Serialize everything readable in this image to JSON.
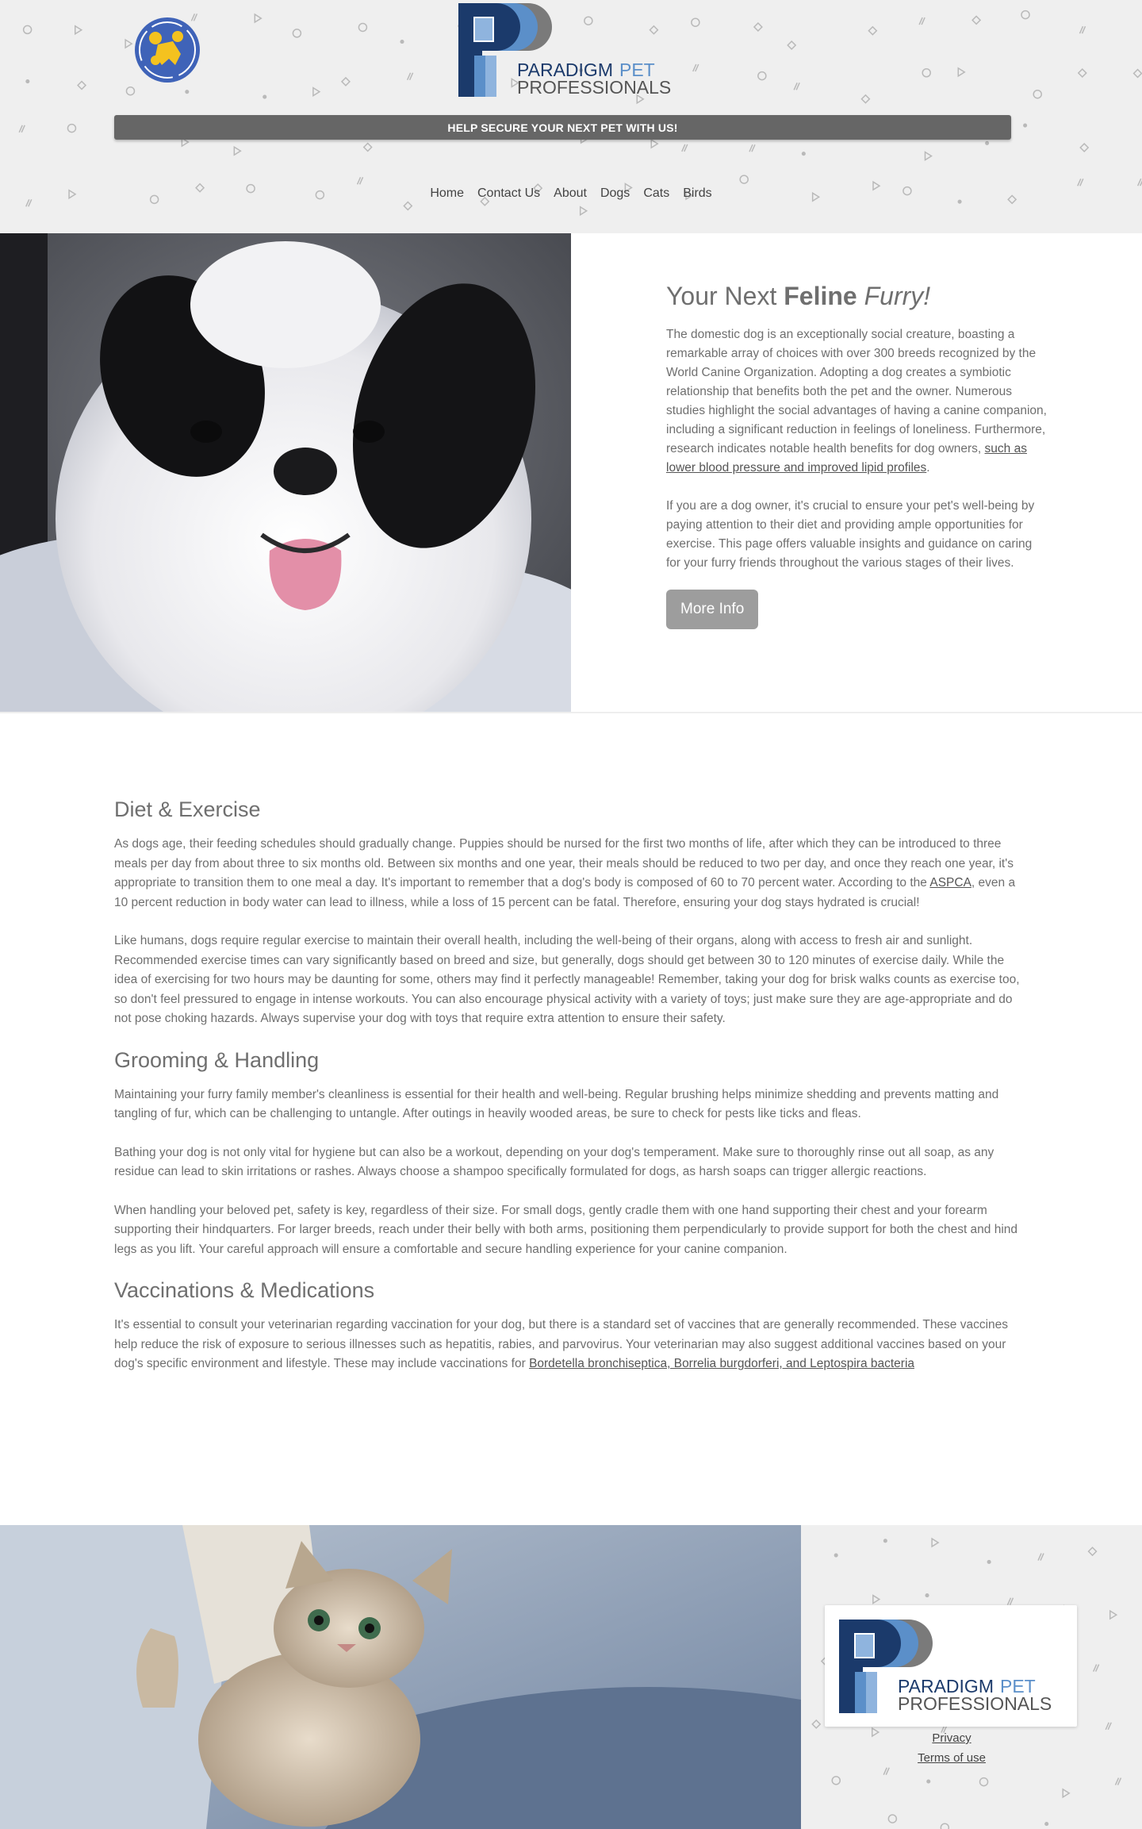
{
  "header": {
    "help_banner": "HELP SECURE YOUR NEXT PET WITH US!",
    "brand_line1": "PARADIGM",
    "brand_line1b": "PET",
    "brand_line2": "PROFESSIONALS"
  },
  "nav": {
    "items": [
      {
        "label": "Home"
      },
      {
        "label": "Contact Us"
      },
      {
        "label": "About"
      },
      {
        "label": "Dogs"
      },
      {
        "label": "Cats"
      },
      {
        "label": "Birds"
      }
    ]
  },
  "hero": {
    "title_prefix": "Your Next ",
    "title_bold": "Feline",
    "title_italic": "Furry!",
    "para1": "The domestic dog is an exceptionally social creature, boasting a remarkable array of choices with over 300 breeds recognized by the World Canine Organization. Adopting a dog creates a symbiotic relationship that benefits both the pet and the owner. Numerous studies highlight the social advantages of having a canine companion, including a significant reduction in feelings of loneliness. Furthermore, research indicates notable health benefits for dog owners, ",
    "para1_link": "such as lower blood pressure and improved lipid profiles",
    "para1_end": ".",
    "para2": "If you are a dog owner, it's crucial to ensure your pet's well-being by paying attention to their diet and providing ample opportunities for exercise. This page offers valuable insights and guidance on caring for your furry friends throughout the various stages of their lives.",
    "button": "More Info"
  },
  "sections": {
    "diet": {
      "heading": "Diet & Exercise",
      "p1_a": "As dogs age, their feeding schedules should gradually change. Puppies should be nursed for the first two months of life, after which they can be introduced to three meals per day from about three to six months old. Between six months and one year, their meals should be reduced to two per day, and once they reach one year, it's appropriate to transition them to one meal a day. It's important to remember that a dog's body is composed of 60 to 70 percent water. According to the ",
      "p1_link": "ASPCA",
      "p1_b": ", even a 10 percent reduction in body water can lead to illness, while a loss of 15 percent can be fatal. Therefore, ensuring your dog stays hydrated is crucial!",
      "p2": "Like humans, dogs require regular exercise to maintain their overall health, including the well-being of their organs, along with access to fresh air and sunlight. Recommended exercise times can vary significantly based on breed and size, but generally, dogs should get between 30 to 120 minutes of exercise daily. While the idea of exercising for two hours may be daunting for some, others may find it perfectly manageable! Remember, taking your dog for brisk walks counts as exercise too, so don't feel pressured to engage in intense workouts. You can also encourage physical activity with a variety of toys; just make sure they are age-appropriate and do not pose choking hazards. Always supervise your dog with toys that require extra attention to ensure their safety."
    },
    "grooming": {
      "heading": "Grooming & Handling",
      "p1": "Maintaining your furry family member's cleanliness is essential for their health and well-being. Regular brushing helps minimize shedding and prevents matting and tangling of fur, which can be challenging to untangle. After outings in heavily wooded areas, be sure to check for pests like ticks and fleas.",
      "p2": "Bathing your dog is not only vital for hygiene but can also be a workout, depending on your dog's temperament. Make sure to thoroughly rinse out all soap, as any residue can lead to skin irritations or rashes. Always choose a shampoo specifically formulated for dogs, as harsh soaps can trigger allergic reactions.",
      "p3": "When handling your beloved pet, safety is key, regardless of their size. For small dogs, gently cradle them with one hand supporting their chest and your forearm supporting their hindquarters. For larger breeds, reach under their belly with both arms, positioning them perpendicularly to provide support for both the chest and hind legs as you lift. Your careful approach will ensure a comfortable and secure handling experience for your canine companion."
    },
    "vaccinations": {
      "heading": "Vaccinations & Medications",
      "p1_a": "It's essential to consult your veterinarian regarding vaccination for your dog, but there is a standard set of vaccines that are generally recommended. These vaccines help reduce the risk of exposure to serious illnesses such as hepatitis, rabies, and parvovirus. Your veterinarian may also suggest additional vaccines based on your dog's specific environment and lifestyle. These may include vaccinations for ",
      "p1_link": "Bordetella bronchiseptica, Borrelia burgdorferi, and Leptospira bacteria"
    }
  },
  "footer": {
    "privacy": "Privacy",
    "terms": "Terms of use"
  },
  "colors": {
    "brand_dark": "#1b3a6b",
    "brand_light": "#5b8fc9",
    "brand_gray": "#6b6b6b",
    "banner": "#666666",
    "button": "#9d9d9d",
    "accent_yellow": "#f4c21f"
  }
}
